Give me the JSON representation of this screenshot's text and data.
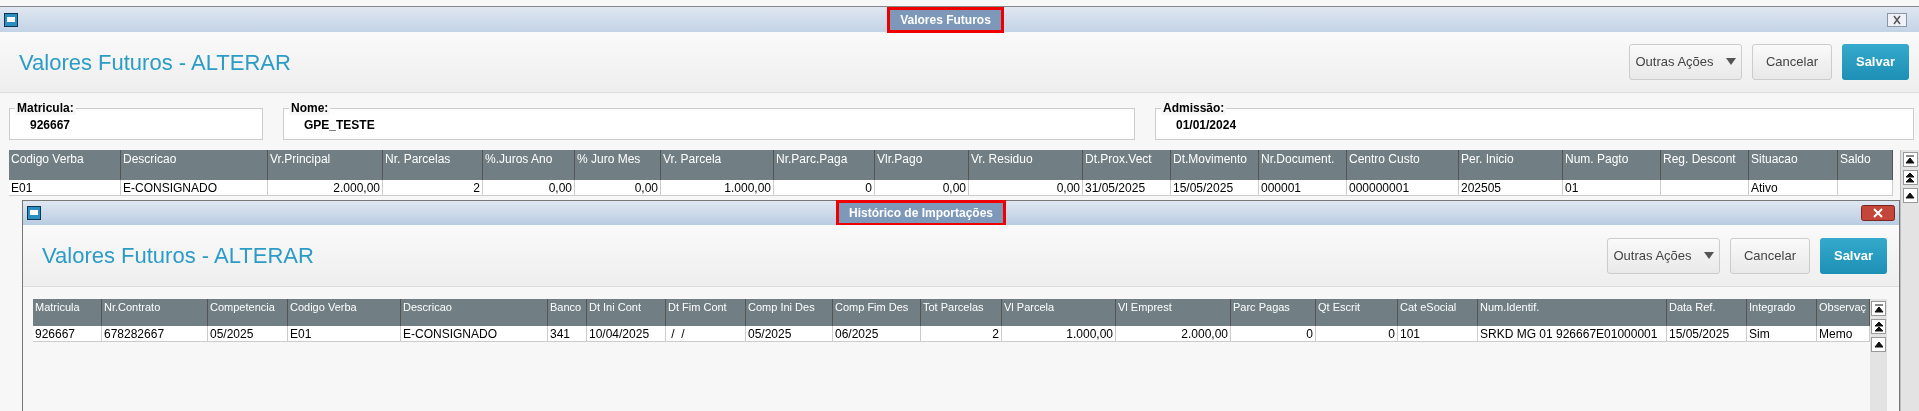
{
  "window": {
    "title": "Valores Futuros",
    "heading": "Valores Futuros - ALTERAR",
    "buttons": [
      {
        "label": "Outras Ações",
        "kind": "menu"
      },
      {
        "label": "Cancelar",
        "kind": "plain"
      },
      {
        "label": "Salvar",
        "kind": "primary"
      }
    ]
  },
  "fields": [
    {
      "label": "Matricula:",
      "value": "926667"
    },
    {
      "label": "Nome:",
      "value": "GPE_TESTE"
    },
    {
      "label": "Admissão:",
      "value": "01/01/2024"
    }
  ],
  "table": {
    "columns": [
      "Codigo Verba",
      "Descricao",
      "Vr.Principal",
      "Nr. Parcelas",
      "%.Juros Ano",
      "% Juro Mes",
      "Vr. Parcela",
      "Nr.Parc.Paga",
      "Vlr.Pago",
      "Vr. Residuo",
      "Dt.Prox.Vect",
      "Dt.Movimento",
      "Nr.Document.",
      "Centro Custo",
      "Per. Inicio",
      "Num. Pagto",
      "Reg. Descont",
      "Situacao",
      "Saldo"
    ],
    "rows": [
      [
        "E01",
        "E-CONSIGNADO",
        "2.000,00",
        "2",
        "0,00",
        "0,00",
        "1.000,00",
        "0",
        "0,00",
        "0,00",
        "31/05/2025",
        "15/05/2025",
        "000001",
        "000000001",
        "202505",
        "01",
        "",
        "Ativo",
        ""
      ]
    ]
  },
  "dialog": {
    "title": "Histórico de Importações",
    "heading": "Valores Futuros - ALTERAR",
    "buttons": [
      {
        "label": "Outras Ações",
        "kind": "menu"
      },
      {
        "label": "Cancelar",
        "kind": "plain"
      },
      {
        "label": "Salvar",
        "kind": "primary"
      }
    ],
    "table": {
      "columns": [
        "Matricula",
        "Nr.Contrato",
        "Competencia",
        "Codigo Verba",
        "Descricao",
        "Banco",
        "Dt Ini Cont",
        "Dt Fim Cont",
        "Comp Ini Des",
        "Comp Fim Des",
        "Tot Parcelas",
        "Vl Parcela",
        "Vl Emprest",
        "Parc Pagas",
        "Qt Escrit",
        "Cat eSocial",
        "Num.Identif.",
        "Data Ref.",
        "Integrado",
        "Observaç"
      ],
      "rows": [
        [
          "926667",
          "678282667",
          "05/2025",
          "E01",
          "E-CONSIGNADO",
          "341",
          "10/04/2025",
          " /  /",
          "05/2025",
          "06/2025",
          "2",
          "1.000,00",
          "2.000,00",
          "0",
          "0",
          "101",
          "SRKD MG 01 926667E01000001",
          "15/05/2025",
          "Sim",
          "Memo"
        ]
      ]
    }
  }
}
